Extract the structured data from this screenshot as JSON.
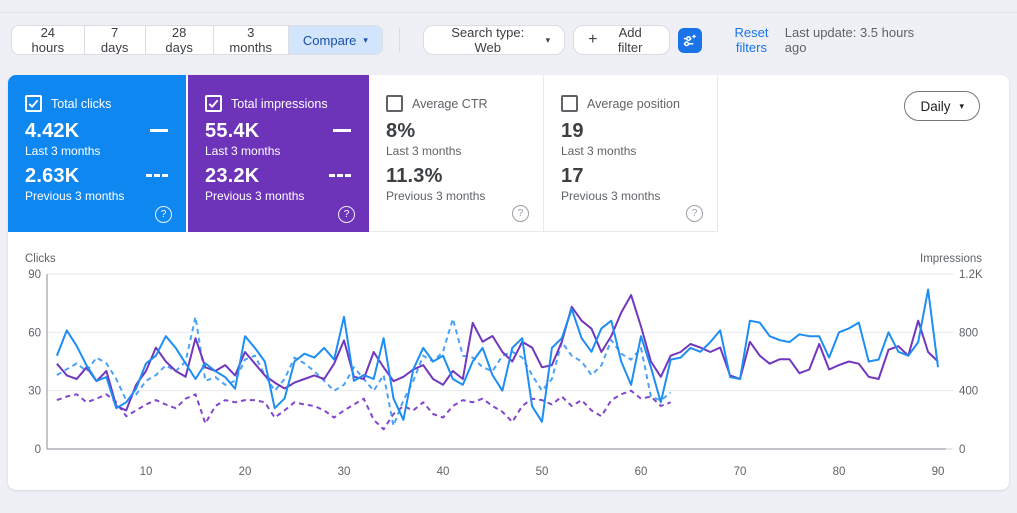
{
  "toolbar": {
    "date_tabs": [
      "24 hours",
      "7 days",
      "28 days",
      "3 months"
    ],
    "compare_label": "Compare",
    "search_type_label": "Search type: Web",
    "add_filter_label": "Add filter",
    "reset_filters_label": "Reset filters",
    "last_update": "Last update: 3.5 hours ago"
  },
  "icons": {
    "caret": "▾",
    "plus": "+",
    "help": "?"
  },
  "colors": {
    "clicks_blue": "#0f87f1",
    "clicks_blue_prev": "#4ba2f4",
    "impressions_purple": "#6d34ba",
    "impressions_purple_line": "#7137bd",
    "impressions_purple_prev": "#8346cf",
    "link_blue": "#1a73e8",
    "compare_chip": "#d3e5fc",
    "page_bg": "#eef0f6"
  },
  "cards": [
    {
      "label": "Total clicks",
      "checked": true,
      "bg": "#0f87f1",
      "value1": "4.42K",
      "period1": "Last 3 months",
      "value2": "2.63K",
      "period2": "Previous 3 months"
    },
    {
      "label": "Total impressions",
      "checked": true,
      "bg": "#6d34ba",
      "value1": "55.4K",
      "period1": "Last 3 months",
      "value2": "23.2K",
      "period2": "Previous 3 months"
    },
    {
      "label": "Average CTR",
      "checked": false,
      "bg": "",
      "value1": "8%",
      "period1": "Last 3 months",
      "value2": "11.3%",
      "period2": "Previous 3 months"
    },
    {
      "label": "Average position",
      "checked": false,
      "bg": "",
      "value1": "19",
      "period1": "Last 3 months",
      "value2": "17",
      "period2": "Previous 3 months"
    }
  ],
  "granularity": {
    "label": "Daily"
  },
  "chart_data": {
    "type": "line",
    "x_axis": {
      "ticks": [
        10,
        20,
        30,
        40,
        50,
        60,
        70,
        80,
        90
      ],
      "range": [
        1,
        90
      ],
      "unit": "day index"
    },
    "left_axis": {
      "title": "Clicks",
      "max": 90,
      "ticks": [
        [
          0,
          "0"
        ],
        [
          30,
          "30"
        ],
        [
          60,
          "60"
        ],
        [
          90,
          "90"
        ]
      ]
    },
    "right_axis": {
      "title": "Impressions",
      "max": 1200,
      "ticks": [
        [
          0,
          "0"
        ],
        [
          400,
          "400"
        ],
        [
          800,
          "800"
        ],
        [
          1200,
          "1.2K"
        ]
      ]
    },
    "grid": "horizontal",
    "legend": "solid = last 3 months, dashed = previous 3 months (shown on metric cards)",
    "series": [
      {
        "name": "Clicks - Last 3 months",
        "axis": "left",
        "style": "solid",
        "color": "#1e8ef2",
        "values": [
          48,
          61,
          53,
          43,
          35,
          37,
          21,
          24,
          31,
          44,
          48,
          58,
          52,
          44,
          36,
          44,
          40,
          37,
          31,
          58,
          52,
          45,
          21,
          26,
          45,
          49,
          47,
          52,
          46,
          68,
          35,
          38,
          36,
          57,
          26,
          15,
          41,
          52,
          45,
          48,
          36,
          33,
          45,
          52,
          38,
          30,
          52,
          57,
          22,
          14,
          52,
          57,
          72,
          57,
          50,
          62,
          66,
          45,
          33,
          58,
          42,
          24,
          46,
          47,
          52,
          50,
          55,
          61,
          37,
          36,
          66,
          65,
          58,
          56,
          55,
          59,
          58,
          58,
          47,
          60,
          62,
          65,
          45,
          46,
          60,
          50,
          48,
          55,
          82,
          42
        ]
      },
      {
        "name": "Clicks - Previous 3 months",
        "axis": "left",
        "style": "dashed",
        "color": "#4ba2f4",
        "values": [
          38,
          41,
          44,
          40,
          47,
          44,
          36,
          25,
          28,
          35,
          38,
          43,
          40,
          45,
          68,
          35,
          37,
          33,
          35,
          46,
          48,
          38,
          30,
          36,
          47,
          44,
          40,
          35,
          30,
          33,
          42,
          36,
          30,
          38,
          12,
          25,
          35,
          48,
          45,
          50,
          67,
          48,
          47,
          42,
          40,
          48,
          50,
          47,
          38,
          30,
          36,
          55,
          48,
          45,
          38,
          43,
          56,
          49,
          46,
          52,
          27,
          25,
          29
        ]
      },
      {
        "name": "Impressions - Last 3 months",
        "axis": "right",
        "style": "solid",
        "color": "#7137bd",
        "values": [
          585,
          505,
          480,
          560,
          465,
          535,
          295,
          265,
          440,
          535,
          695,
          600,
          535,
          495,
          760,
          560,
          535,
          575,
          505,
          665,
          585,
          505,
          455,
          415,
          455,
          480,
          505,
          480,
          585,
          745,
          495,
          480,
          665,
          560,
          465,
          495,
          545,
          575,
          480,
          440,
          535,
          480,
          865,
          735,
          775,
          665,
          600,
          735,
          695,
          560,
          575,
          735,
          975,
          880,
          825,
          665,
          775,
          935,
          1055,
          840,
          600,
          495,
          640,
          665,
          720,
          695,
          665,
          695,
          505,
          480,
          735,
          640,
          585,
          615,
          615,
          520,
          545,
          720,
          545,
          575,
          600,
          585,
          495,
          480,
          680,
          705,
          640,
          880,
          665,
          600
        ]
      },
      {
        "name": "Impressions - Previous 3 months",
        "axis": "right",
        "style": "dashed",
        "color": "#8346cf",
        "values": [
          335,
          360,
          375,
          320,
          345,
          375,
          320,
          225,
          265,
          305,
          335,
          305,
          280,
          345,
          375,
          175,
          295,
          335,
          320,
          335,
          335,
          320,
          215,
          265,
          320,
          305,
          295,
          265,
          215,
          265,
          305,
          345,
          200,
          135,
          240,
          295,
          265,
          320,
          240,
          215,
          295,
          335,
          320,
          345,
          295,
          255,
          185,
          295,
          345,
          335,
          305,
          360,
          295,
          335,
          265,
          225,
          335,
          375,
          400,
          345,
          360,
          295,
          320
        ]
      }
    ]
  }
}
